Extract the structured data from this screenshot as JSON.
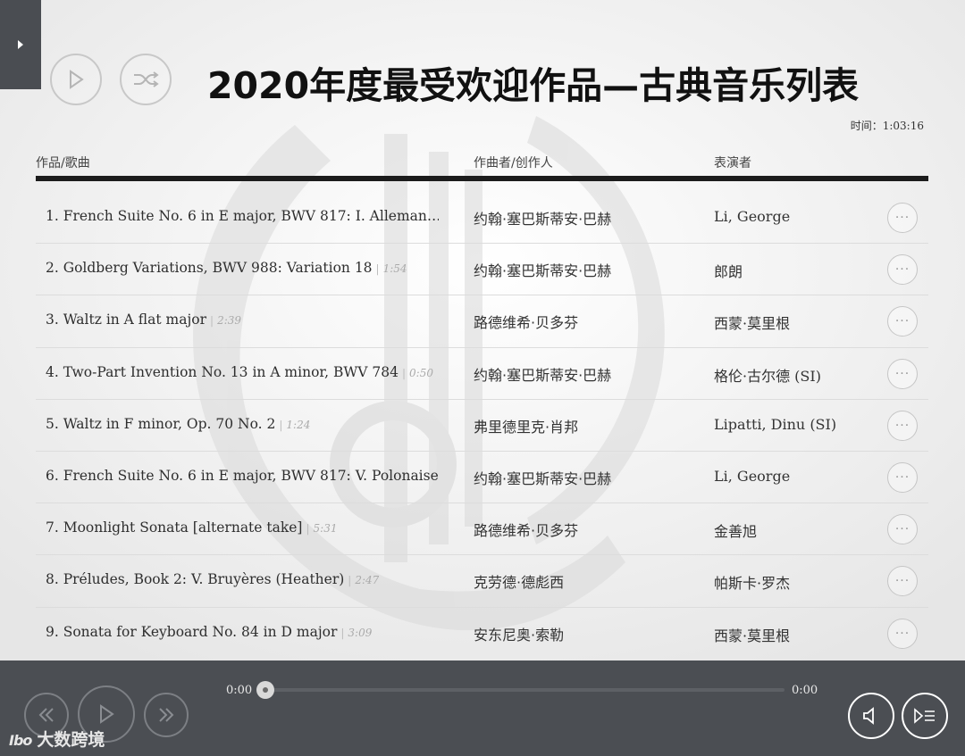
{
  "header": {
    "title": "2020年度最受欢迎作品—古典音乐列表",
    "duration": "时间：1:03:16"
  },
  "columns": {
    "title": "作品/歌曲",
    "composer": "作曲者/创作人",
    "performer": "表演者"
  },
  "tracks": [
    {
      "title": "1. French Suite No. 6 in E major, BWV 817: I. Alleman…",
      "length": "",
      "composer": "约翰·塞巴斯蒂安·巴赫",
      "performer": "Li, George"
    },
    {
      "title": "2. Goldberg Variations, BWV 988: Variation 18",
      "length": "1:54",
      "composer": "约翰·塞巴斯蒂安·巴赫",
      "performer": "郎朗"
    },
    {
      "title": "3. Waltz in A flat major",
      "length": "2:39",
      "composer": "路德维希·贝多芬",
      "performer": "西蒙·莫里根"
    },
    {
      "title": "4. Two-Part Invention No. 13 in A minor, BWV 784",
      "length": "0:50",
      "composer": "约翰·塞巴斯蒂安·巴赫",
      "performer": "格伦·古尔德 (SI)"
    },
    {
      "title": "5. Waltz in F minor, Op. 70 No. 2",
      "length": "1:24",
      "composer": "弗里德里克·肖邦",
      "performer": "Lipatti, Dinu (SI)"
    },
    {
      "title": "6. French Suite No. 6 in E major, BWV 817: V. Polonaise…",
      "length": "",
      "composer": "约翰·塞巴斯蒂安·巴赫",
      "performer": "Li, George"
    },
    {
      "title": "7. Moonlight Sonata [alternate take]",
      "length": "5:31",
      "composer": "路德维希·贝多芬",
      "performer": "金善旭"
    },
    {
      "title": "8. Préludes, Book 2: V. Bruyères (Heather)",
      "length": "2:47",
      "composer": "克劳德·德彪西",
      "performer": "帕斯卡·罗杰"
    },
    {
      "title": "9. Sonata for Keyboard No. 84 in D major",
      "length": "3:09",
      "composer": "安东尼奥·索勒",
      "performer": "西蒙·莫里根"
    }
  ],
  "player": {
    "current_time": "0:00",
    "total_time": "0:00",
    "progress": 0
  },
  "watermark": {
    "logo": "Ibo",
    "text": "大数跨境"
  },
  "colors": {
    "player_bg": "#4b4e53",
    "side_tab": "#4a4d52",
    "rule": "#1c1c1c"
  }
}
